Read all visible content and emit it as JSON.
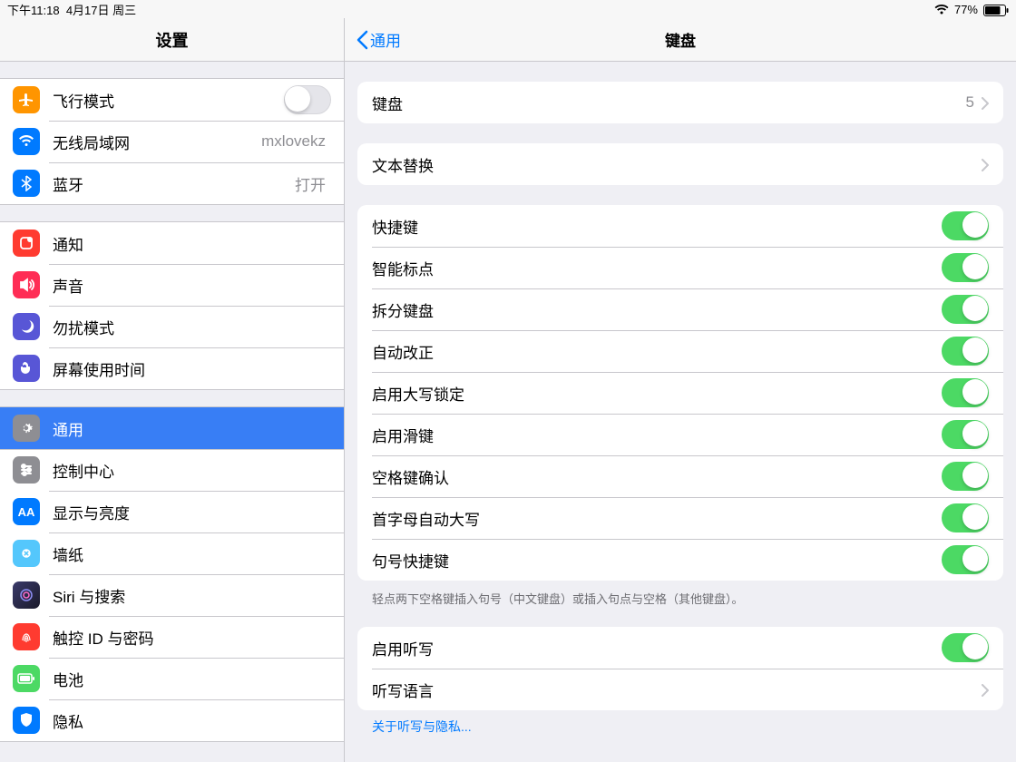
{
  "statusbar": {
    "time": "下午11:18",
    "date": "4月17日 周三",
    "battery_pct": "77%"
  },
  "sidebar": {
    "title": "设置",
    "group1": [
      {
        "icon": "airplane-icon",
        "color": "#ff9500",
        "label": "飞行模式",
        "toggle": false
      },
      {
        "icon": "wifi-icon",
        "color": "#007aff",
        "label": "无线局域网",
        "detail": "mxlovekz"
      },
      {
        "icon": "bluetooth-icon",
        "color": "#007aff",
        "label": "蓝牙",
        "detail": "打开"
      }
    ],
    "group2": [
      {
        "icon": "notifications-icon",
        "color": "#ff3b30",
        "label": "通知"
      },
      {
        "icon": "sounds-icon",
        "color": "#ff2d55",
        "label": "声音"
      },
      {
        "icon": "dnd-icon",
        "color": "#5856d6",
        "label": "勿扰模式"
      },
      {
        "icon": "screentime-icon",
        "color": "#5856d6",
        "label": "屏幕使用时间"
      }
    ],
    "group3": [
      {
        "icon": "general-icon",
        "color": "#8e8e93",
        "label": "通用",
        "selected": true
      },
      {
        "icon": "controlcenter-icon",
        "color": "#8e8e93",
        "label": "控制中心"
      },
      {
        "icon": "display-icon",
        "color": "#007aff",
        "label": "显示与亮度"
      },
      {
        "icon": "wallpaper-icon",
        "color": "#54c7fc",
        "label": "墙纸"
      },
      {
        "icon": "siri-icon",
        "color": "#000",
        "label": "Siri 与搜索"
      },
      {
        "icon": "touchid-icon",
        "color": "#ff3b30",
        "label": "触控 ID 与密码"
      },
      {
        "icon": "battery-icon",
        "color": "#4cd964",
        "label": "电池"
      },
      {
        "icon": "privacy-icon",
        "color": "#007aff",
        "label": "隐私"
      }
    ]
  },
  "main": {
    "back_label": "通用",
    "title": "键盘",
    "section1": {
      "keyboards_label": "键盘",
      "keyboards_count": "5"
    },
    "section2": {
      "text_replace_label": "文本替换"
    },
    "section3": {
      "toggles": [
        {
          "label": "快捷键",
          "on": true
        },
        {
          "label": "智能标点",
          "on": true
        },
        {
          "label": "拆分键盘",
          "on": true
        },
        {
          "label": "自动改正",
          "on": true
        },
        {
          "label": "启用大写锁定",
          "on": true
        },
        {
          "label": "启用滑键",
          "on": true
        },
        {
          "label": "空格键确认",
          "on": true
        },
        {
          "label": "首字母自动大写",
          "on": true
        },
        {
          "label": "句号快捷键",
          "on": true
        }
      ],
      "footer": "轻点两下空格键插入句号（中文键盘）或插入句点与空格（其他键盘）。"
    },
    "section4": {
      "dictation_label": "启用听写",
      "dictation_on": true,
      "dictation_lang_label": "听写语言",
      "footer_link": "关于听写与隐私..."
    }
  }
}
